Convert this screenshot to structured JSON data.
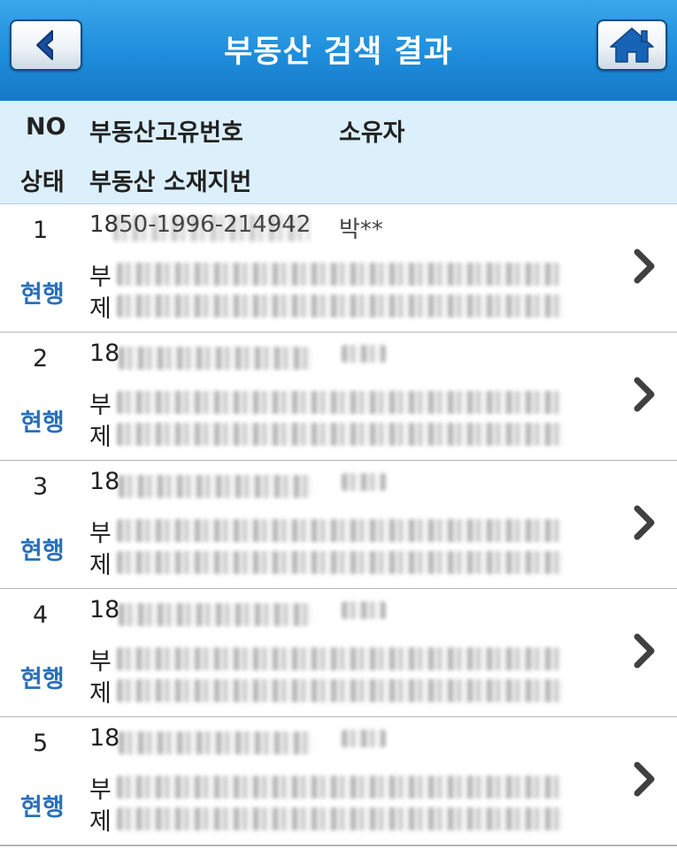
{
  "header": {
    "title": "부동산 검색 결과",
    "back_icon": "chevron-left-icon",
    "home_icon": "home-icon",
    "accent_color": "#1e8ddb"
  },
  "columns": {
    "no": "NO",
    "property_id": "부동산고유번호",
    "owner": "소유자",
    "status": "상태",
    "address": "부동산 소재지번"
  },
  "results": [
    {
      "no": "1",
      "status": "현행",
      "id_prefix": "1850-1996-214942",
      "owner_prefix": "박**",
      "addr_prefix1": "부",
      "addr_prefix2": "제"
    },
    {
      "no": "2",
      "status": "현행",
      "id_prefix": "18",
      "owner_prefix": "",
      "addr_prefix1": "부",
      "addr_prefix2": "제"
    },
    {
      "no": "3",
      "status": "현행",
      "id_prefix": "18",
      "owner_prefix": "",
      "addr_prefix1": "부",
      "addr_prefix2": "제"
    },
    {
      "no": "4",
      "status": "현행",
      "id_prefix": "18",
      "owner_prefix": "",
      "addr_prefix1": "부",
      "addr_prefix2": "제"
    },
    {
      "no": "5",
      "status": "현행",
      "id_prefix": "18",
      "owner_prefix": "",
      "addr_prefix1": "부",
      "addr_prefix2": "제"
    }
  ],
  "row_chevron_icon": "chevron-right-icon",
  "status_color": "#2a6fb8"
}
